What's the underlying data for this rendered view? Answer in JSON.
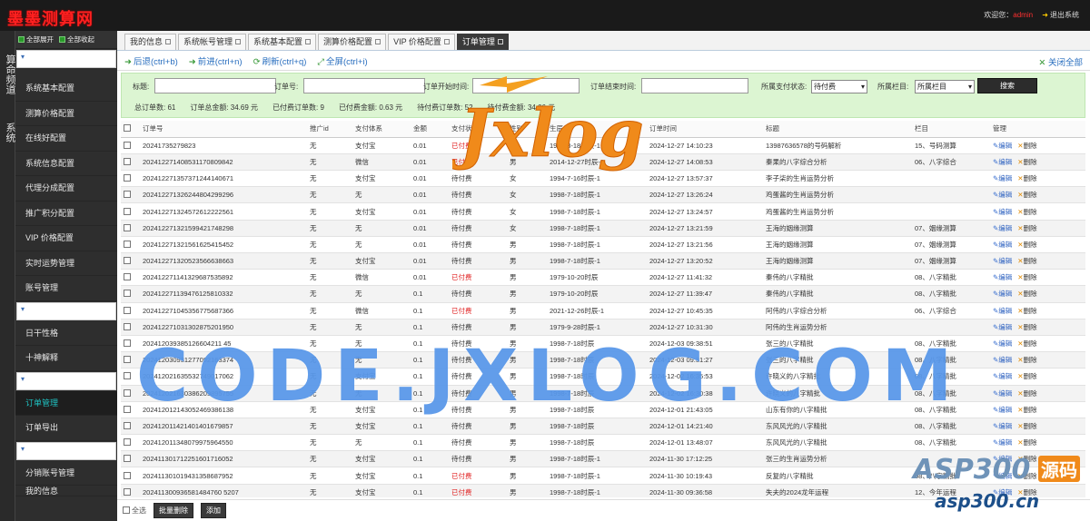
{
  "header": {
    "logo": "墨墨测算网",
    "welcome_label": "欢迎您：",
    "user": "admin",
    "logout": "退出系统"
  },
  "vnav": [
    "算命频道",
    "系统"
  ],
  "sidemenu": {
    "expand_all": "全部展开",
    "collapse_all": "全部收起",
    "group1": [
      "系统基本配置",
      "测算价格配置",
      "在线好配置",
      "系统信息配置",
      "代理分成配置",
      "推广积分配置",
      "VIP 价格配置",
      "实时运势管理",
      "账号管理"
    ],
    "group2": [
      "日干性格",
      "十神解释"
    ],
    "group3": [
      "订单管理",
      "订单导出"
    ],
    "group4": [
      "分销账号管理",
      "我的信息"
    ]
  },
  "tabs": [
    {
      "label": "我的信息",
      "active": false
    },
    {
      "label": "系统帐号管理",
      "active": false
    },
    {
      "label": "系统基本配置",
      "active": false
    },
    {
      "label": "测算价格配置",
      "active": false
    },
    {
      "label": "VIP 价格配置",
      "active": false
    },
    {
      "label": "订单管理",
      "active": true
    }
  ],
  "toolbar": {
    "back": "后退(ctrl+b)",
    "forward": "前进(ctrl+n)",
    "refresh": "刷新(ctrl+q)",
    "fullscreen": "全屏(ctrl+i)",
    "close_all": "关闭全部"
  },
  "search": {
    "title_label": "标题:",
    "order_label": "订单号:",
    "start_label": "订单开始时间:",
    "end_label": "订单结束时间:",
    "pay_status_label": "所属支付状态:",
    "pay_status_value": "待付费",
    "column_label": "所属栏目:",
    "column_value": "所属栏目",
    "search_button": "搜索"
  },
  "stats": {
    "total_orders": "总订单数: 61",
    "total_amount": "订单总金额: 34.69 元",
    "paid_orders": "已付费订单数: 9",
    "paid_amount": "已付费金额: 0.63 元",
    "unpaid_orders": "待付费订单数: 52",
    "unpaid_amount": "待付费金额: 34.06 元"
  },
  "table": {
    "headers": [
      "订单号",
      "推广id",
      "支付体系",
      "金额",
      "支付状态",
      "性别",
      "生辰",
      "订单时间",
      "标题",
      "栏目",
      "管理"
    ],
    "edit_label": "编辑",
    "delete_label": "删除",
    "rows": [
      [
        "20241735279823",
        "无",
        "支付宝",
        "0.01",
        "已付费",
        "女",
        "1988-3-18时辰-1",
        "2024-12-27 14:10:23",
        "13987636578的号码解析",
        "15、号码测算"
      ],
      [
        "202412271408531170809842",
        "无",
        "微信",
        "0.01",
        "已付费",
        "男",
        "2014-12-27时辰-1",
        "2024-12-27 14:08:53",
        "秦果的八字综合分析",
        "06、八字综合"
      ],
      [
        "202412271357371244140671",
        "无",
        "支付宝",
        "0.01",
        "待付费",
        "女",
        "1994-7-16时辰-1",
        "2024-12-27 13:57:37",
        "李子柒的生肖运势分析",
        ""
      ],
      [
        "202412271326244804299296",
        "无",
        "无",
        "0.01",
        "待付费",
        "女",
        "1998-7-18时辰-1",
        "2024-12-27 13:26:24",
        "鸡蛋酱的生肖运势分析",
        ""
      ],
      [
        "202412271324572612222561",
        "无",
        "支付宝",
        "0.01",
        "待付费",
        "女",
        "1998-7-18时辰-1",
        "2024-12-27 13:24:57",
        "鸡蛋酱的生肖运势分析",
        ""
      ],
      [
        "202412271321599421748298",
        "无",
        "无",
        "0.01",
        "待付费",
        "女",
        "1998-7-18时辰-1",
        "2024-12-27 13:21:59",
        "王海的姻缘测算",
        "07、姻缘测算"
      ],
      [
        "202412271321561625415452",
        "无",
        "无",
        "0.01",
        "待付费",
        "男",
        "1998-7-18时辰-1",
        "2024-12-27 13:21:56",
        "王海的姻缘测算",
        "07、姻缘测算"
      ],
      [
        "202412271320523566638663",
        "无",
        "支付宝",
        "0.01",
        "待付费",
        "男",
        "1998-7-18时辰-1",
        "2024-12-27 13:20:52",
        "王海的姻缘测算",
        "07、姻缘测算"
      ],
      [
        "202412271141329687535892",
        "无",
        "微信",
        "0.01",
        "已付费",
        "男",
        "1979-10-20时辰",
        "2024-12-27 11:41:32",
        "秦伟的八字精批",
        "08、八字精批"
      ],
      [
        "202412271139476125810332",
        "无",
        "无",
        "0.1",
        "待付费",
        "男",
        "1979-10-20时辰",
        "2024-12-27 11:39:47",
        "秦伟的八字精批",
        "08、八字精批"
      ],
      [
        "202412271045356775687366",
        "无",
        "微信",
        "0.1",
        "已付费",
        "男",
        "2021-12-26时辰-1",
        "2024-12-27 10:45:35",
        "阿伟的八字综合分析",
        "06、八字综合"
      ],
      [
        "202412271031302875201950",
        "无",
        "无",
        "0.1",
        "待付费",
        "男",
        "1979-9-28时辰-1",
        "2024-12-27 10:31:30",
        "阿伟的生肖运势分析",
        ""
      ],
      [
        "202412039385126604211 45",
        "无",
        "无",
        "0.1",
        "待付费",
        "男",
        "1998-7-18时辰",
        "2024-12-03 09:38:51",
        "张三的八字精批",
        "08、八字精批"
      ],
      [
        "202412030931277092163374",
        "无",
        "无",
        "0.1",
        "待付费",
        "男",
        "1998-7-18时辰",
        "2024-12-03 09:31:27",
        "张三的八字精批",
        "08、八字精批"
      ],
      [
        "202412021635532749017062",
        "无",
        "支付宝",
        "0.1",
        "待付费",
        "男",
        "1998-7-18时辰",
        "2024-12-02 16:35:53",
        "许晓义的八字精批",
        "08、八字精批"
      ],
      [
        "202412021630386209895755",
        "无",
        "无",
        "0.1",
        "待付费",
        "男",
        "1998-7-18时辰",
        "2024-12-02 16:30:38",
        "许晓义的八字精批",
        "08、八字精批"
      ],
      [
        "202412012143052469386138",
        "无",
        "支付宝",
        "0.1",
        "待付费",
        "男",
        "1998-7-18时辰",
        "2024-12-01 21:43:05",
        "山东有你的八字精批",
        "08、八字精批"
      ],
      [
        "202412011421401401679857",
        "无",
        "支付宝",
        "0.1",
        "待付费",
        "男",
        "1998-7-18时辰",
        "2024-12-01 14:21:40",
        "东风风光的八字精批",
        "08、八字精批"
      ],
      [
        "202412011348079975964550",
        "无",
        "无",
        "0.1",
        "待付费",
        "男",
        "1998-7-18时辰",
        "2024-12-01 13:48:07",
        "东风风光的八字精批",
        "08、八字精批"
      ],
      [
        "202411301712251601716052",
        "无",
        "支付宝",
        "0.1",
        "待付费",
        "男",
        "1998-7-18时辰-1",
        "2024-11-30 17:12:25",
        "张三的生肖运势分析",
        ""
      ],
      [
        "202411301019431358687952",
        "无",
        "支付宝",
        "0.1",
        "已付费",
        "男",
        "1998-7-18时辰-1",
        "2024-11-30 10:19:43",
        "反复的八字精批",
        "08、八字精批"
      ],
      [
        "202411300936581484760 5207",
        "无",
        "支付宝",
        "0.1",
        "已付费",
        "男",
        "1998-7-18时辰-1",
        "2024-11-30 09:36:58",
        "失夫的2024龙年运程",
        "12、今年运程"
      ]
    ]
  },
  "footer": {
    "select_all": "全选",
    "batch_delete": "批量删除",
    "add": "添加"
  },
  "watermarks": {
    "brand": "Jxlog",
    "site": "CODE.JXLOG.COM",
    "badge_a": "ASP300",
    "badge_b": "源码",
    "badge_c": "asp300.cn"
  },
  "colors": {
    "paid": "#e02020",
    "accent_green": "#dcf5d2",
    "link": "#2a6fbf"
  }
}
